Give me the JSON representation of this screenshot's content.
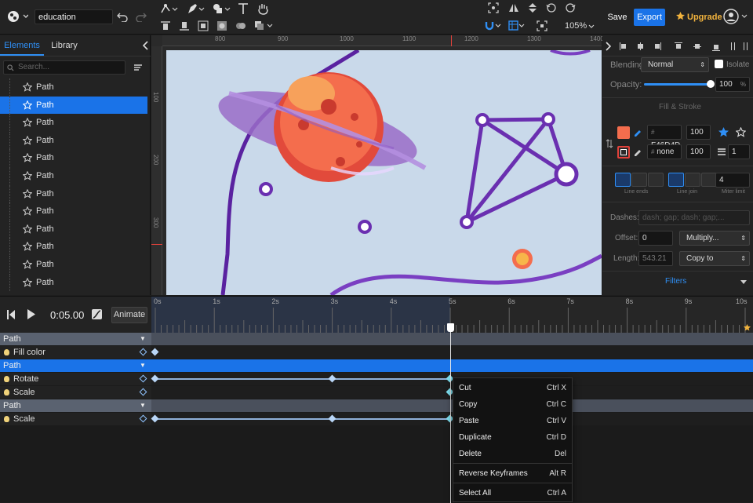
{
  "topbar": {
    "document_name": "education",
    "save_label": "Save",
    "export_label": "Export",
    "upgrade_label": "Upgrade",
    "zoom_level": "105%"
  },
  "left_panel": {
    "tabs": [
      "Elements",
      "Library"
    ],
    "search_placeholder": "Search...",
    "layers": [
      {
        "label": "Path",
        "selected": false
      },
      {
        "label": "Path",
        "selected": true
      },
      {
        "label": "Path",
        "selected": false
      },
      {
        "label": "Path",
        "selected": false
      },
      {
        "label": "Path",
        "selected": false
      },
      {
        "label": "Path",
        "selected": false
      },
      {
        "label": "Path",
        "selected": false
      },
      {
        "label": "Path",
        "selected": false
      },
      {
        "label": "Path",
        "selected": false
      },
      {
        "label": "Path",
        "selected": false
      },
      {
        "label": "Path",
        "selected": false
      },
      {
        "label": "Path",
        "selected": false
      }
    ]
  },
  "rulers": {
    "top": [
      "800",
      "900",
      "1000",
      "1100",
      "1200",
      "1300",
      "1400"
    ],
    "left": [
      "100",
      "200",
      "300"
    ]
  },
  "right_panel": {
    "blending_label": "Blending:",
    "blending_value": "Normal",
    "isolate_label": "Isolate",
    "opacity_label": "Opacity:",
    "opacity_value": "100",
    "opacity_unit": "%",
    "opacity_fraction": 1.0,
    "section_fill_stroke": "Fill & Stroke",
    "fill_color_hex": "F46D4D",
    "fill_color": "#F46D4D",
    "fill_opacity": "100",
    "stroke_value": "none",
    "stroke_opacity": "100",
    "stroke_width": "1",
    "line_ends_label": "Line ends",
    "line_join_label": "Line join",
    "miter_value": "4",
    "miter_label": "Miter limit",
    "dashes_label": "Dashes:",
    "dashes_placeholder": "dash; gap; dash; gap;...",
    "offset_label": "Offset:",
    "offset_value": "0",
    "offset_select": "Multiply...",
    "length_label": "Length:",
    "length_value": "543.21",
    "length_select": "Copy to",
    "filters_label": "Filters"
  },
  "timeline": {
    "time_display": "0:05.00",
    "animate_label": "Animate",
    "seconds": [
      "0s",
      "1s",
      "2s",
      "3s",
      "4s",
      "5s",
      "6s",
      "7s",
      "8s",
      "9s",
      "10s"
    ],
    "playhead_seconds": 5,
    "tracks": [
      {
        "name": "Path",
        "highlight": false,
        "props": [
          {
            "name": "Fill color",
            "keyframes": [
              0
            ]
          }
        ]
      },
      {
        "name": "Path",
        "highlight": true,
        "props": [
          {
            "name": "Rotate",
            "keyframes": [
              0,
              3,
              5
            ]
          },
          {
            "name": "Scale",
            "keyframes": [
              5
            ]
          }
        ]
      },
      {
        "name": "Path",
        "highlight": false,
        "props": [
          {
            "name": "Scale",
            "keyframes": [
              0,
              3,
              5
            ]
          }
        ]
      }
    ]
  },
  "context_menu": {
    "items": [
      {
        "label": "Cut",
        "shortcut": "Ctrl X"
      },
      {
        "label": "Copy",
        "shortcut": "Ctrl C"
      },
      {
        "label": "Paste",
        "shortcut": "Ctrl V"
      },
      {
        "label": "Duplicate",
        "shortcut": "Ctrl D"
      },
      {
        "label": "Delete",
        "shortcut": "Del"
      },
      {
        "label": "Reverse Keyframes",
        "shortcut": "Alt R"
      },
      {
        "label": "Select All",
        "shortcut": "Ctrl A"
      }
    ]
  },
  "colors": {
    "accent": "#1a73e8",
    "canvas_bg": "#c9d9ea",
    "purple": "#6a2fb0",
    "planet": "#f46d4d",
    "upgrade": "#f2b33d"
  }
}
